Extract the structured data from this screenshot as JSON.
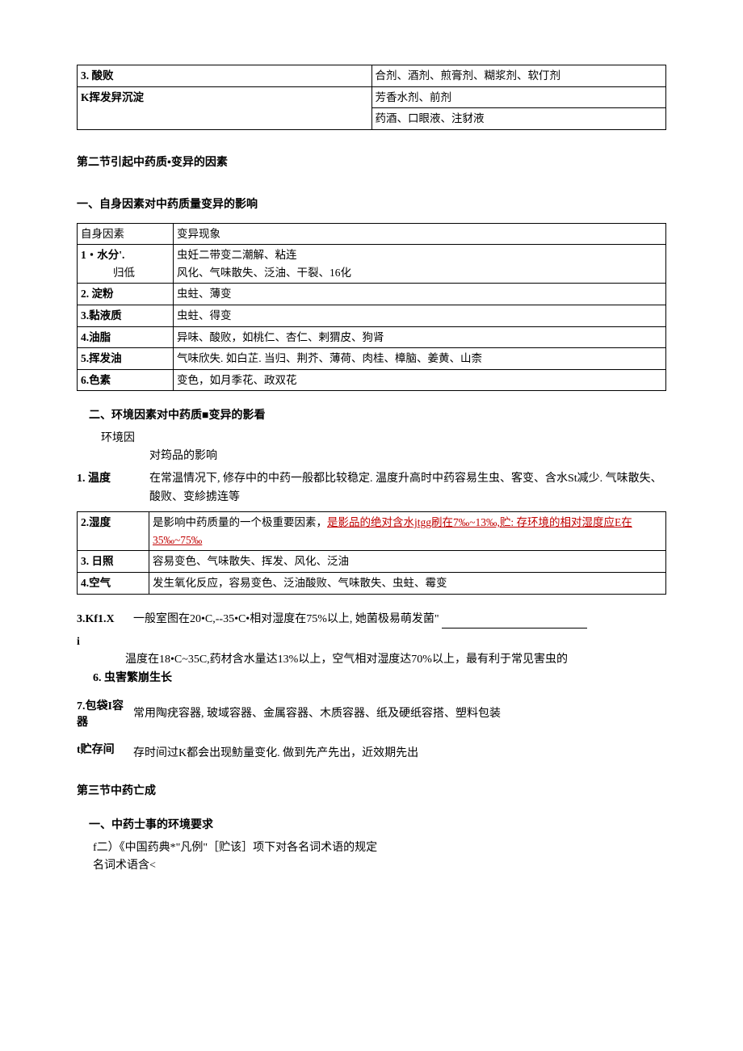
{
  "table1": {
    "rows": [
      {
        "c1": "3. 酸败",
        "c2": "合剂、酒剂、煎膏剂、糊浆剂、软仃剂"
      },
      {
        "c1": "K挥发舁沉淀",
        "c2a": "芳香水剂、前剂",
        "c2b": "药酒、口眼液、注豺液"
      }
    ]
  },
  "section2_title": "第二节引起中药质•变异的因素",
  "sub1_title": "一、自身因素对中药质量变异的影响",
  "table2": {
    "header": {
      "c1": "自身因素",
      "c2": "变异现象"
    },
    "row1": {
      "c1a": "1・水分'.",
      "c1b": "归低",
      "c2a": "虫妊二带变二潮解、粘连",
      "c2b": "风化、气味散失、泛油、干裂、16化"
    },
    "rows": [
      {
        "c1": "2. 淀粉",
        "c2": "虫蛀、薄变"
      },
      {
        "c1": "3.黏液质",
        "c2": "虫蛀、得变"
      },
      {
        "c1": "4.油脂",
        "c2": "异味、酸败，如桃仁、杏仁、剌猬皮、狗肾"
      },
      {
        "c1": "5.挥发油",
        "c2": "气味欣失. 如白芷. 当归、荆芥、薄荷、肉桂、樟脑、姜黄、山柰"
      },
      {
        "c1": "6.色素",
        "c2": "变色，如月季花、政双花"
      }
    ]
  },
  "sub2_title": "二、环境因素对中药质■变异的影看",
  "env_label": "环境因",
  "env_desc": "对筠品的影响",
  "env1_lbl": "1. 温度",
  "env1_txt": "在常温情况下, 修存中的中药一般都比较稳定. 温度升高时中药容易生虫、客变、含水St减少.  气味散失、酸败、变紾掳连等",
  "table3": {
    "row2": {
      "c1": "2.湿度",
      "c2a": "是影响中药质量的一个极重要因素，",
      "c2b": "是影品的绝对含水jtgg刷在7‰~13‰,贮: 存环境的相对湿度应E在35‰~75‰"
    },
    "rows": [
      {
        "c1": "3. 日照",
        "c2": "容易变色、气味散失、挥发、风化、泛油"
      },
      {
        "c1": "4.空气",
        "c2": "发生氧化反应，容易变色、泛油酸败、气味散失、虫蛀、霉变"
      }
    ]
  },
  "env5_lbl": "3.Kf1.X",
  "env5_txt": "一般室图在20•C,--35•C•相对湿度在75%以上, 她菌极易萌发菌\"",
  "env_i": "i",
  "env6_pre": "温度在18•C~35C,药材含水量达13%以上，空气相对湿度达70%以上，最有利于常见害虫的",
  "env6_lbl": "6. 虫害繁崩生长",
  "env7_lbl": "7.包袋I容器",
  "env7_txt": "常用陶疣容器, 玻域容器、金属容器、木质容器、纸及硬纸容搭、塑料包装",
  "env8_lbl": "t贮存间",
  "env8_txt": "存时间过K都会出现魴量变化. 做到先产先出，近效期先出",
  "section3_title": "第三节中药亡成",
  "sub3_title": "一、中药士事的环境要求",
  "line_f": "f二）《中国药典*\"凡例\"［贮该］项下对各名词术语的规定",
  "line_g": "名词术语含<"
}
